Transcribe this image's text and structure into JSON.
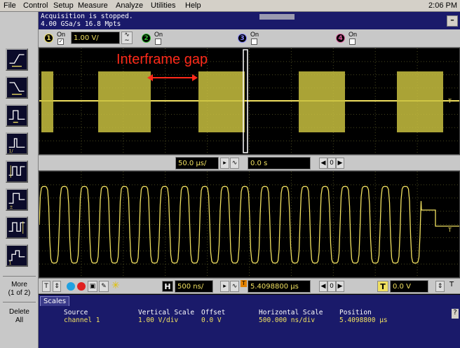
{
  "menu": {
    "items": [
      "File",
      "Control",
      "Setup",
      "Measure",
      "Analyze",
      "Utilities",
      "Help"
    ],
    "clock": "2:06 PM"
  },
  "status": {
    "line1": "Acquisition is stopped.",
    "line2": "4.00 GSa/s   16.8 Mpts",
    "minimize": "–"
  },
  "channels": [
    {
      "number": "1",
      "on_label": "On",
      "checked": true,
      "color": "#f0e060",
      "scale": "1.00 V/"
    },
    {
      "number": "2",
      "on_label": "On",
      "checked": false,
      "color": "#30c030"
    },
    {
      "number": "3",
      "on_label": "On",
      "checked": false,
      "color": "#5050d0"
    },
    {
      "number": "4",
      "on_label": "On",
      "checked": false,
      "color": "#d04080"
    }
  ],
  "annotation": "Interframe gap",
  "upper_timebase": {
    "scale": "50.0 µs/",
    "position": "0.0 s",
    "nav_prev": "◀",
    "nav_zero": "0",
    "nav_next": "▶"
  },
  "lower_timebase": {
    "h_label": "H",
    "scale": "500 ns/",
    "t_label": "T",
    "position": "5.4098800 µs",
    "trigger_label": "T",
    "trigger_level": "0.0 V",
    "nav_prev": "◀",
    "nav_zero": "0",
    "nav_next": "▶"
  },
  "side": {
    "more_label": "More",
    "more_sub": "(1 of 2)",
    "delete_label": "Delete",
    "delete_sub": "All"
  },
  "scales": {
    "tab": "Scales",
    "headers": {
      "source": "Source",
      "vscale": "Vertical Scale",
      "offset": "Offset",
      "hscale": "Horizontal Scale",
      "position": "Position"
    },
    "values": {
      "source": "channel 1",
      "vscale": "1.00 V/div",
      "offset": "0.0 V",
      "hscale": "500.000 ns/div",
      "position": "5.4098800 µs"
    },
    "help": "?"
  },
  "colors": {
    "trace": "#f0e060",
    "annotation": "#ff2a1a",
    "grid": "#6a6a2a",
    "panel_bg": "#000000"
  }
}
